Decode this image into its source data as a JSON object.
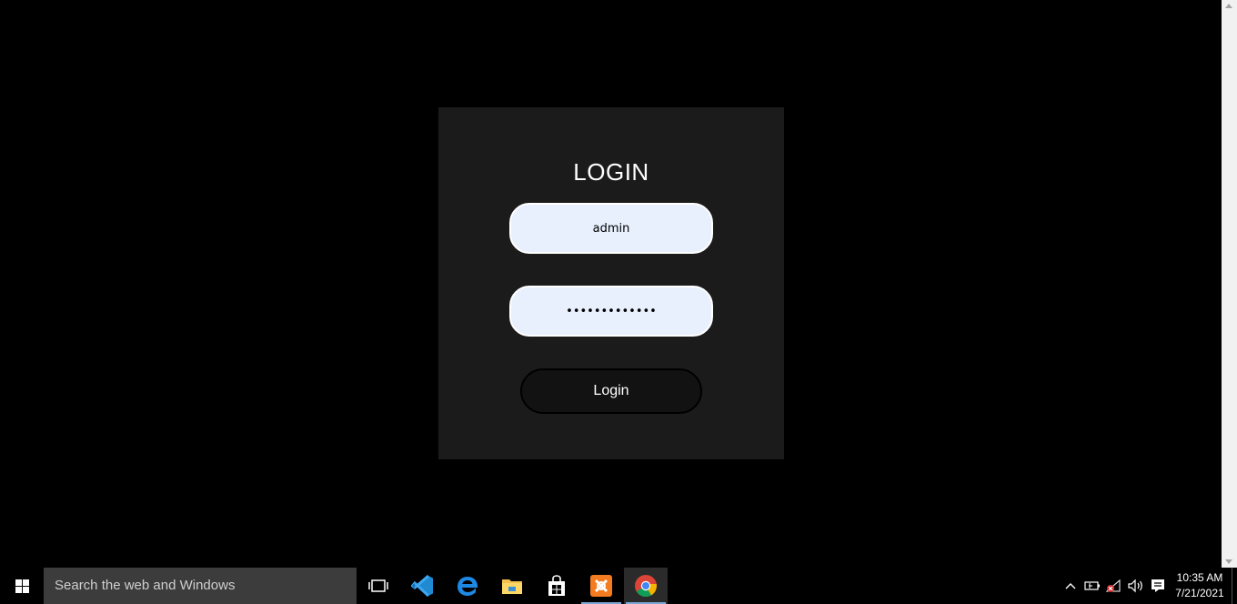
{
  "login": {
    "title": "LOGIN",
    "username_value": "admin",
    "password_value": "•••••••••••••",
    "button_label": "Login"
  },
  "taskbar": {
    "search_placeholder": "Search the web and Windows",
    "apps": [
      "task-view-icon",
      "vscode-icon",
      "edge-icon",
      "file-explorer-icon",
      "store-icon",
      "xampp-icon",
      "chrome-icon"
    ],
    "clock_time": "10:35 AM",
    "clock_date": "7/21/2021"
  },
  "colors": {
    "card_bg": "#1b1b1b",
    "field_bg": "#e8f0fe",
    "page_bg": "#000000",
    "taskbar_search_bg": "#3c3c3c"
  }
}
